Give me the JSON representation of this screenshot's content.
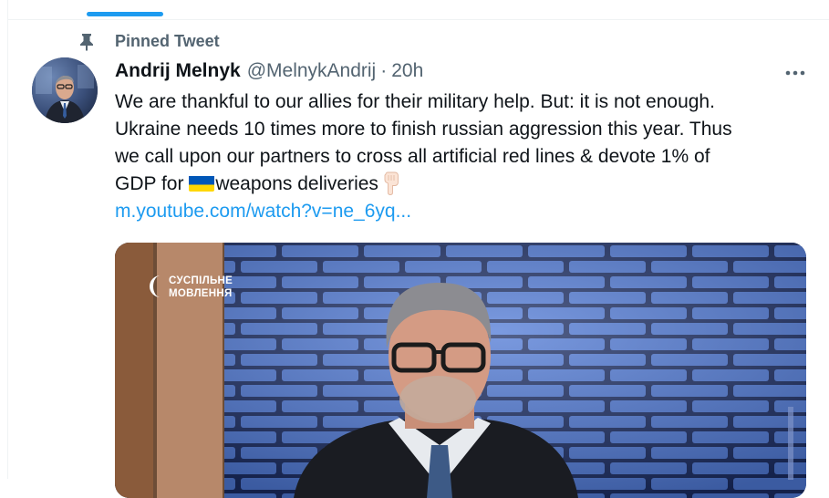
{
  "timeline": {
    "pinned_label": "Pinned Tweet"
  },
  "tweet": {
    "author_name": "Andrij Melnyk",
    "author_handle": "@MelnykAndrij",
    "separator": "·",
    "time": "20h",
    "lines": [
      "We are thankful to our allies for their military help. But: it is not enough.",
      "Ukraine needs 10 times more to finish russian aggression this year. Thus",
      "we call upon our partners to cross all artificial red lines & devote 1% of"
    ],
    "last_line_start": "GDP for ",
    "last_line_end": "weapons deliveries",
    "link_text": "m.youtube.com/watch?v=ne_6yq...",
    "more_label": "•••"
  },
  "media": {
    "broadcaster_line1": "СУСПІЛЬНЕ",
    "broadcaster_line2": "МОВЛЕННЯ"
  },
  "colors": {
    "accent": "#1d9bf0",
    "secondary_text": "#536471",
    "primary_text": "#0f1419",
    "flag_blue": "#0057b7",
    "flag_yellow": "#ffd700"
  },
  "icons": {
    "pin": "pin-icon",
    "more": "more-icon",
    "flag": "ukraine-flag-icon",
    "pointing_down": "backhand-index-pointing-down-icon"
  }
}
